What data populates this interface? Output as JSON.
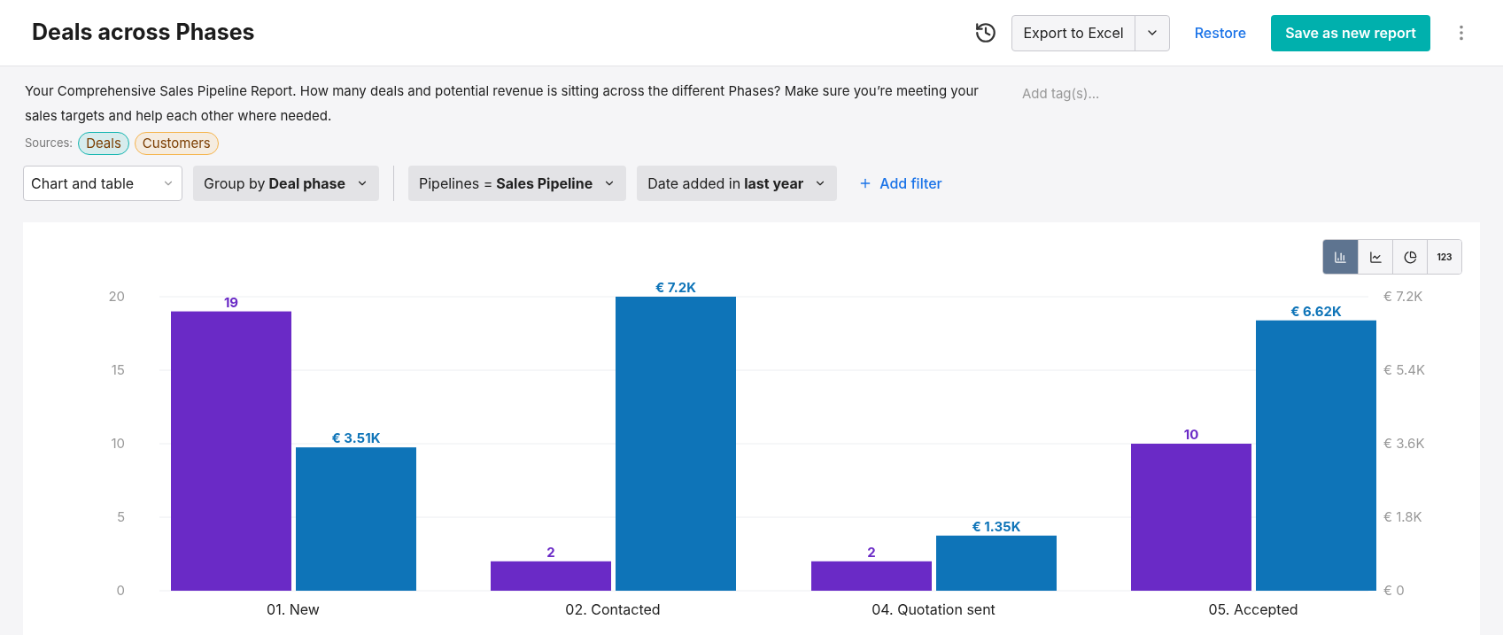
{
  "header": {
    "title": "Deals across Phases",
    "export_button": "Export to Excel",
    "restore_link": "Restore",
    "save_button": "Save as new report"
  },
  "description": "Your Comprehensive Sales Pipeline Report. How many deals and potential revenue is sitting across the different Phases? Make sure you’re meeting your sales targets and help each other where needed.",
  "tags_placeholder": "Add tag(s)...",
  "sources": {
    "label": "Sources:",
    "items": [
      {
        "label": "Deals",
        "color": "#13b5b0"
      },
      {
        "label": "Customers",
        "color": "#f5b44c"
      }
    ]
  },
  "filters": {
    "view_select": "Chart and table",
    "items": [
      {
        "prefix": "Group by",
        "value": "Deal phase"
      },
      {
        "prefix": "Pipelines =",
        "value": "Sales Pipeline"
      },
      {
        "prefix": "Date added in",
        "value": "last year"
      }
    ],
    "add_filter": "Add filter"
  },
  "chart_types": [
    {
      "kind": "bar",
      "selected": true
    },
    {
      "kind": "line",
      "selected": false
    },
    {
      "kind": "pie",
      "selected": false
    },
    {
      "kind": "number",
      "label": "123",
      "selected": false
    }
  ],
  "chart_data": {
    "type": "bar",
    "categories": [
      "01. New",
      "02. Contacted",
      "04. Quotation sent",
      "05. Accepted"
    ],
    "grid": true,
    "series": [
      {
        "color": "#6a2ac6",
        "values": [
          19,
          2,
          2,
          10
        ],
        "value_labels": [
          "19",
          "2",
          "2",
          "10"
        ]
      },
      {
        "axis": "y2",
        "color": "#0e74b8",
        "values": [
          3510,
          7200,
          1350,
          6620
        ],
        "value_labels": [
          "€ 3.51K",
          "€ 7.2K",
          "€ 1.35K",
          "€ 6.62K"
        ]
      }
    ],
    "ylim": [
      0,
      20
    ],
    "yticks": [
      0,
      5,
      10,
      15,
      20
    ],
    "y2lim": [
      0,
      7200
    ],
    "y2ticks": [
      {
        "value": 0,
        "label": "€ 0"
      },
      {
        "value": 1800,
        "label": "€ 1.8K"
      },
      {
        "value": 3600,
        "label": "€ 3.6K"
      },
      {
        "value": 5400,
        "label": "€ 5.4K"
      },
      {
        "value": 7200,
        "label": "€ 7.2K"
      }
    ]
  }
}
